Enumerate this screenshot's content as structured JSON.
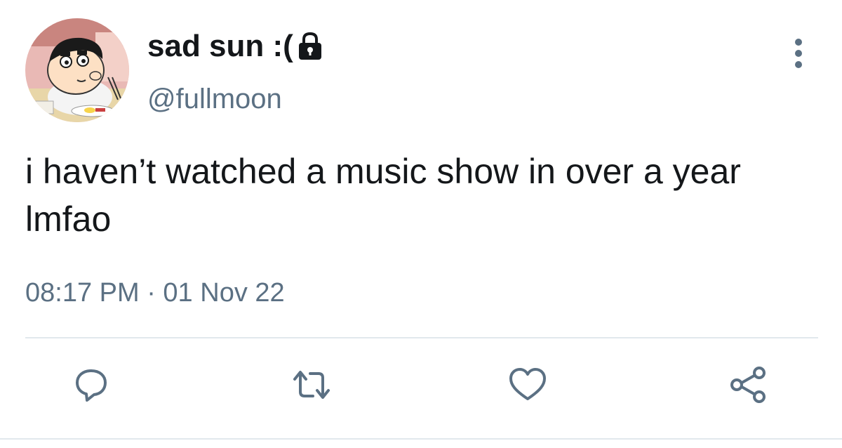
{
  "tweet": {
    "display_name": "sad sun :(",
    "username": "@fullmoon",
    "text": "i haven’t watched a music show in over a year lmfao",
    "timestamp": "08:17 PM · 01 Nov 22",
    "protected_icon": "lock-icon"
  },
  "actions": [
    {
      "name": "reply",
      "icon": "speech-bubble-icon"
    },
    {
      "name": "retweet",
      "icon": "retweet-icon"
    },
    {
      "name": "like",
      "icon": "heart-icon"
    },
    {
      "name": "share",
      "icon": "share-icon"
    }
  ],
  "colors": {
    "text": "#14171a",
    "secondary": "#5b7083",
    "divider": "#e1e8ed"
  }
}
